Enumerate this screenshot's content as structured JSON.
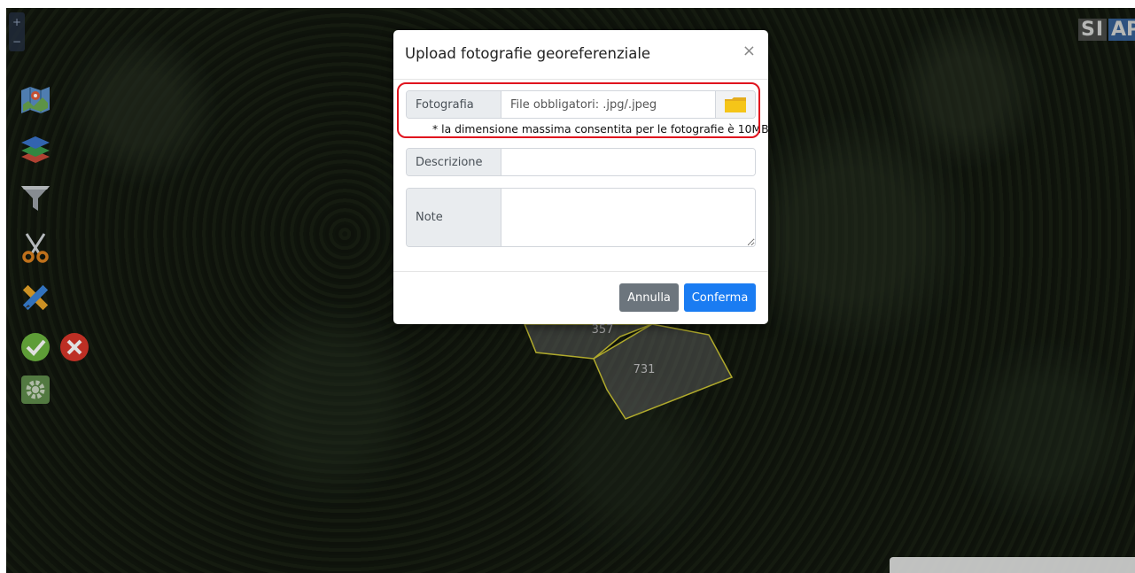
{
  "map": {
    "zoom_in": "+",
    "zoom_out": "−",
    "logo_left": "SI",
    "logo_right": "AP",
    "parcels": [
      "357",
      "731"
    ],
    "tools": [
      "map-icon",
      "layers-icon",
      "filter-icon",
      "scissors-icon",
      "ruler-pencil-icon",
      "check-icon",
      "cancel-icon",
      "gear-icon"
    ]
  },
  "modal": {
    "title": "Upload fotografie georeferenziale",
    "close": "×",
    "photo_label": "Fotografia",
    "photo_placeholder": "File obbligatori: .jpg/.jpeg",
    "photo_note": "* la dimensione massima consentita per le fotografie è 10MB",
    "description_label": "Descrizione",
    "description_value": "",
    "notes_label": "Note",
    "notes_value": "",
    "cancel_label": "Annulla",
    "confirm_label": "Conferma"
  },
  "colors": {
    "highlight": "#e0141e",
    "confirm": "#1a7cf2",
    "cancel": "#6c757d",
    "parcel_border": "#c9c233"
  }
}
